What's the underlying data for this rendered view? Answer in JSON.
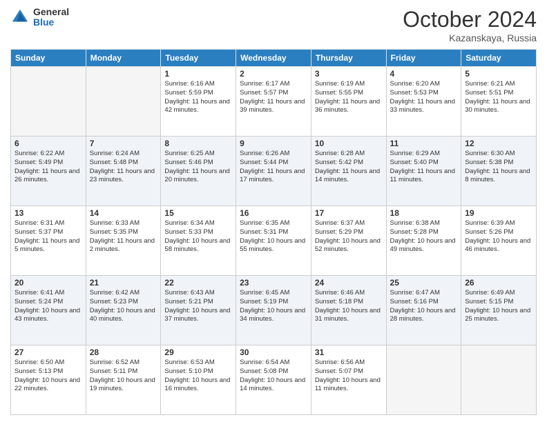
{
  "header": {
    "logo_general": "General",
    "logo_blue": "Blue",
    "month": "October 2024",
    "location": "Kazanskaya, Russia"
  },
  "weekdays": [
    "Sunday",
    "Monday",
    "Tuesday",
    "Wednesday",
    "Thursday",
    "Friday",
    "Saturday"
  ],
  "weeks": [
    [
      {
        "day": "",
        "sunrise": "",
        "sunset": "",
        "daylight": ""
      },
      {
        "day": "",
        "sunrise": "",
        "sunset": "",
        "daylight": ""
      },
      {
        "day": "1",
        "sunrise": "Sunrise: 6:16 AM",
        "sunset": "Sunset: 5:59 PM",
        "daylight": "Daylight: 11 hours and 42 minutes."
      },
      {
        "day": "2",
        "sunrise": "Sunrise: 6:17 AM",
        "sunset": "Sunset: 5:57 PM",
        "daylight": "Daylight: 11 hours and 39 minutes."
      },
      {
        "day": "3",
        "sunrise": "Sunrise: 6:19 AM",
        "sunset": "Sunset: 5:55 PM",
        "daylight": "Daylight: 11 hours and 36 minutes."
      },
      {
        "day": "4",
        "sunrise": "Sunrise: 6:20 AM",
        "sunset": "Sunset: 5:53 PM",
        "daylight": "Daylight: 11 hours and 33 minutes."
      },
      {
        "day": "5",
        "sunrise": "Sunrise: 6:21 AM",
        "sunset": "Sunset: 5:51 PM",
        "daylight": "Daylight: 11 hours and 30 minutes."
      }
    ],
    [
      {
        "day": "6",
        "sunrise": "Sunrise: 6:22 AM",
        "sunset": "Sunset: 5:49 PM",
        "daylight": "Daylight: 11 hours and 26 minutes."
      },
      {
        "day": "7",
        "sunrise": "Sunrise: 6:24 AM",
        "sunset": "Sunset: 5:48 PM",
        "daylight": "Daylight: 11 hours and 23 minutes."
      },
      {
        "day": "8",
        "sunrise": "Sunrise: 6:25 AM",
        "sunset": "Sunset: 5:46 PM",
        "daylight": "Daylight: 11 hours and 20 minutes."
      },
      {
        "day": "9",
        "sunrise": "Sunrise: 6:26 AM",
        "sunset": "Sunset: 5:44 PM",
        "daylight": "Daylight: 11 hours and 17 minutes."
      },
      {
        "day": "10",
        "sunrise": "Sunrise: 6:28 AM",
        "sunset": "Sunset: 5:42 PM",
        "daylight": "Daylight: 11 hours and 14 minutes."
      },
      {
        "day": "11",
        "sunrise": "Sunrise: 6:29 AM",
        "sunset": "Sunset: 5:40 PM",
        "daylight": "Daylight: 11 hours and 11 minutes."
      },
      {
        "day": "12",
        "sunrise": "Sunrise: 6:30 AM",
        "sunset": "Sunset: 5:38 PM",
        "daylight": "Daylight: 11 hours and 8 minutes."
      }
    ],
    [
      {
        "day": "13",
        "sunrise": "Sunrise: 6:31 AM",
        "sunset": "Sunset: 5:37 PM",
        "daylight": "Daylight: 11 hours and 5 minutes."
      },
      {
        "day": "14",
        "sunrise": "Sunrise: 6:33 AM",
        "sunset": "Sunset: 5:35 PM",
        "daylight": "Daylight: 11 hours and 2 minutes."
      },
      {
        "day": "15",
        "sunrise": "Sunrise: 6:34 AM",
        "sunset": "Sunset: 5:33 PM",
        "daylight": "Daylight: 10 hours and 58 minutes."
      },
      {
        "day": "16",
        "sunrise": "Sunrise: 6:35 AM",
        "sunset": "Sunset: 5:31 PM",
        "daylight": "Daylight: 10 hours and 55 minutes."
      },
      {
        "day": "17",
        "sunrise": "Sunrise: 6:37 AM",
        "sunset": "Sunset: 5:29 PM",
        "daylight": "Daylight: 10 hours and 52 minutes."
      },
      {
        "day": "18",
        "sunrise": "Sunrise: 6:38 AM",
        "sunset": "Sunset: 5:28 PM",
        "daylight": "Daylight: 10 hours and 49 minutes."
      },
      {
        "day": "19",
        "sunrise": "Sunrise: 6:39 AM",
        "sunset": "Sunset: 5:26 PM",
        "daylight": "Daylight: 10 hours and 46 minutes."
      }
    ],
    [
      {
        "day": "20",
        "sunrise": "Sunrise: 6:41 AM",
        "sunset": "Sunset: 5:24 PM",
        "daylight": "Daylight: 10 hours and 43 minutes."
      },
      {
        "day": "21",
        "sunrise": "Sunrise: 6:42 AM",
        "sunset": "Sunset: 5:23 PM",
        "daylight": "Daylight: 10 hours and 40 minutes."
      },
      {
        "day": "22",
        "sunrise": "Sunrise: 6:43 AM",
        "sunset": "Sunset: 5:21 PM",
        "daylight": "Daylight: 10 hours and 37 minutes."
      },
      {
        "day": "23",
        "sunrise": "Sunrise: 6:45 AM",
        "sunset": "Sunset: 5:19 PM",
        "daylight": "Daylight: 10 hours and 34 minutes."
      },
      {
        "day": "24",
        "sunrise": "Sunrise: 6:46 AM",
        "sunset": "Sunset: 5:18 PM",
        "daylight": "Daylight: 10 hours and 31 minutes."
      },
      {
        "day": "25",
        "sunrise": "Sunrise: 6:47 AM",
        "sunset": "Sunset: 5:16 PM",
        "daylight": "Daylight: 10 hours and 28 minutes."
      },
      {
        "day": "26",
        "sunrise": "Sunrise: 6:49 AM",
        "sunset": "Sunset: 5:15 PM",
        "daylight": "Daylight: 10 hours and 25 minutes."
      }
    ],
    [
      {
        "day": "27",
        "sunrise": "Sunrise: 6:50 AM",
        "sunset": "Sunset: 5:13 PM",
        "daylight": "Daylight: 10 hours and 22 minutes."
      },
      {
        "day": "28",
        "sunrise": "Sunrise: 6:52 AM",
        "sunset": "Sunset: 5:11 PM",
        "daylight": "Daylight: 10 hours and 19 minutes."
      },
      {
        "day": "29",
        "sunrise": "Sunrise: 6:53 AM",
        "sunset": "Sunset: 5:10 PM",
        "daylight": "Daylight: 10 hours and 16 minutes."
      },
      {
        "day": "30",
        "sunrise": "Sunrise: 6:54 AM",
        "sunset": "Sunset: 5:08 PM",
        "daylight": "Daylight: 10 hours and 14 minutes."
      },
      {
        "day": "31",
        "sunrise": "Sunrise: 6:56 AM",
        "sunset": "Sunset: 5:07 PM",
        "daylight": "Daylight: 10 hours and 11 minutes."
      },
      {
        "day": "",
        "sunrise": "",
        "sunset": "",
        "daylight": ""
      },
      {
        "day": "",
        "sunrise": "",
        "sunset": "",
        "daylight": ""
      }
    ]
  ]
}
